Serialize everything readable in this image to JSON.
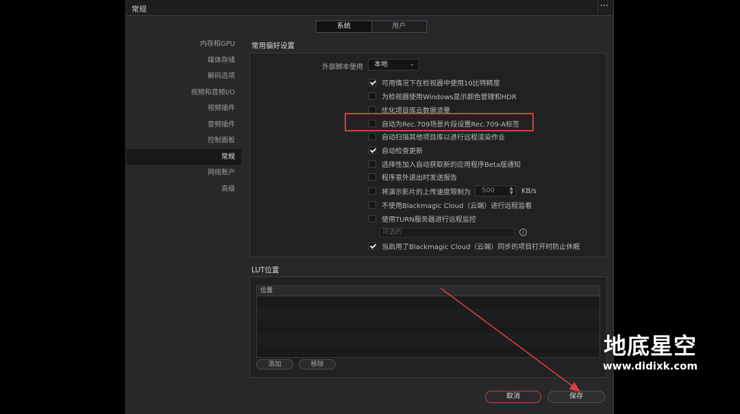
{
  "window": {
    "title": "常规",
    "more_icon": "⋯"
  },
  "tabs": [
    {
      "label": "系统",
      "active": true
    },
    {
      "label": "用户",
      "active": false
    }
  ],
  "sidebar": {
    "items": [
      {
        "label": "内存和GPU"
      },
      {
        "label": "媒体存储"
      },
      {
        "label": "解码选项"
      },
      {
        "label": "视频和音频I/O"
      },
      {
        "label": "视频插件"
      },
      {
        "label": "音频插件"
      },
      {
        "label": "控制面板"
      },
      {
        "label": "常规",
        "active": true
      },
      {
        "label": "网络账户"
      },
      {
        "label": "高级"
      }
    ]
  },
  "general": {
    "section_title": "常用偏好设置",
    "external_script_label": "外部脚本使用",
    "external_script_value": "本地",
    "checkboxes": [
      {
        "label": "可用情况下在检视器中使用10比特精度",
        "checked": true
      },
      {
        "label": "为检视器使用Windows显示颜色管理和HDR",
        "checked": false
      },
      {
        "label": "优化项目库云数据流量",
        "checked": false
      },
      {
        "label": "自动为Rec.709场景片段设置Rec.709-A标签",
        "checked": false
      },
      {
        "label": "自动扫描其他项目库以进行远程渲染作业",
        "checked": false
      },
      {
        "label": "自动检查更新",
        "checked": true
      },
      {
        "label": "选择性加入自动获取新的应用程序Beta版通知",
        "checked": false
      },
      {
        "label": "程序意外退出时发送报告",
        "checked": false
      },
      {
        "label": "将演示影片的上传速度限制为",
        "checked": false
      },
      {
        "label": "不使用Blackmagic Cloud（云端）进行远程监看",
        "checked": false
      },
      {
        "label": "使用TURN服务器进行远程监控",
        "checked": false
      },
      {
        "label": "当启用了Blackmagic Cloud（云端）同步的项目打开时防止休眠",
        "checked": true
      }
    ],
    "upload_limit_value": "500",
    "upload_limit_unit": "KB/s",
    "optional_placeholder": "可选的",
    "info_icon": "i"
  },
  "lut": {
    "section_title": "LUT位置",
    "column_header": "位置",
    "add_label": "添加",
    "remove_label": "移除"
  },
  "footer": {
    "cancel_label": "取消",
    "save_label": "保存"
  },
  "watermark": {
    "main": "地底星空",
    "url": "www.didixk.com"
  },
  "colors": {
    "highlight": "#d9413d",
    "active_bg": "#18181a"
  }
}
